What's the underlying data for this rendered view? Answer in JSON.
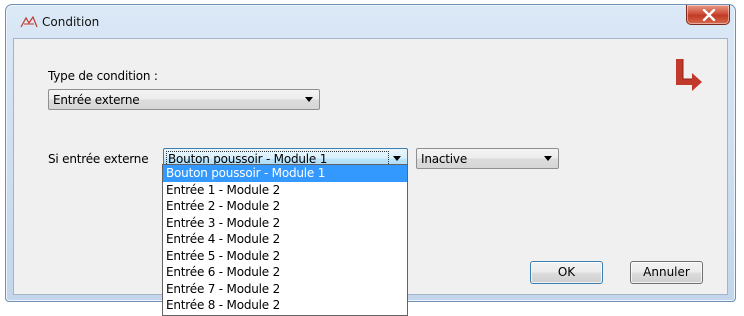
{
  "window": {
    "title": "Condition",
    "title_icon": "condition-icon",
    "close_icon": "close-x-icon"
  },
  "form": {
    "type_label": "Type de condition :",
    "type_value": "Entrée externe",
    "if_label": "Si entrée externe",
    "input_value": "Bouton poussoir - Module 1",
    "state_value": "Inactive"
  },
  "dropdown": {
    "items": [
      "Bouton poussoir - Module 1",
      "Entrée 1 - Module 2",
      "Entrée 2 - Module 2",
      "Entrée 3 - Module 2",
      "Entrée 4 - Module 2",
      "Entrée 5 - Module 2",
      "Entrée 6 - Module 2",
      "Entrée 7 - Module 2",
      "Entrée 8 - Module 2"
    ],
    "selected_index": 0
  },
  "buttons": {
    "ok": "OK",
    "cancel": "Annuler"
  },
  "colors": {
    "brand": "#c0392b",
    "selection": "#3399ff"
  },
  "brand_icon": "brand-arrow-logo"
}
